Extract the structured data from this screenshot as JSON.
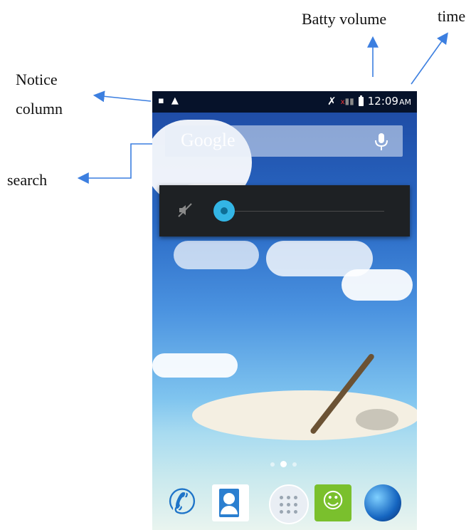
{
  "annotations": {
    "time": "time",
    "batty_volume": "Batty volume",
    "notice_line1": "Notice",
    "notice_line2": "column",
    "search": "search"
  },
  "status_bar": {
    "time": "12:09",
    "ampm": "AM",
    "left_icons": [
      "image-icon",
      "warning-icon"
    ],
    "right_icons": [
      "mute-icon",
      "signal-icon",
      "battery-icon"
    ]
  },
  "search_widget": {
    "logo_text": "Google",
    "mic_icon": "mic-icon"
  },
  "volume_panel": {
    "icon": "speaker-muted-icon",
    "level": 0
  },
  "dock": {
    "apps": [
      "phone-icon",
      "contacts-icon",
      "apps-drawer-icon",
      "messaging-icon",
      "browser-icon"
    ]
  },
  "page_indicator": {
    "count": 3,
    "active": 1
  }
}
